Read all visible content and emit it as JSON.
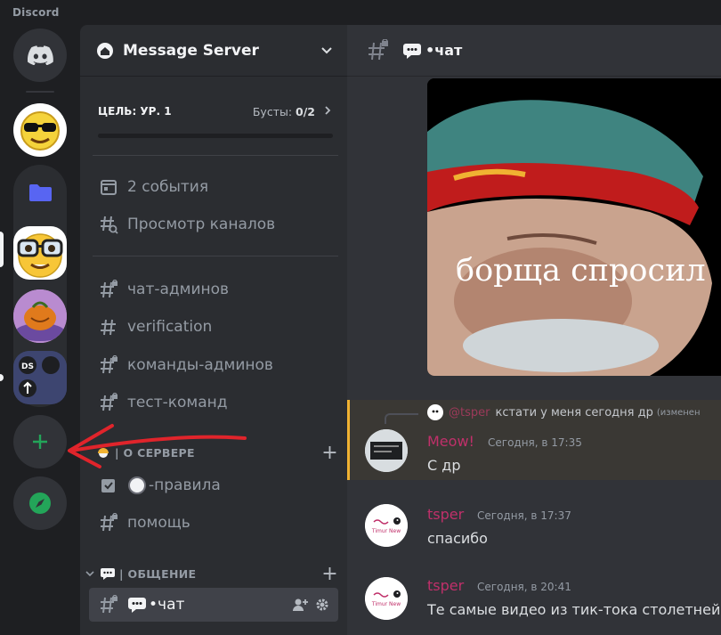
{
  "app": {
    "name": "Discord"
  },
  "server": {
    "name": "Message Server",
    "boost": {
      "goal": "ЦЕЛЬ: УР. 1",
      "label": "Бусты: ",
      "value": "0/2",
      "progress": 0
    }
  },
  "nav": [
    {
      "label": "2 события",
      "icon": "calendar-icon"
    },
    {
      "label": "Просмотр каналов",
      "icon": "browse-channels-icon"
    }
  ],
  "channels": [
    {
      "label": "чат-админов",
      "icon": "locked-hash-icon"
    },
    {
      "label": "verification",
      "icon": "hash-icon"
    },
    {
      "label": "команды-админов",
      "icon": "locked-hash-icon"
    },
    {
      "label": "тест-команд",
      "icon": "locked-hash-icon"
    }
  ],
  "categories": [
    {
      "name": "| О СЕРВЕРЕ",
      "emoji_icon": "sun-emoji-icon"
    },
    {
      "name": "| ОБЩЕНИЕ",
      "emoji_icon": "speech-bubble-icon"
    }
  ],
  "about_channels": [
    {
      "label": "-правила",
      "icon": "rules-icon"
    },
    {
      "label": "помощь",
      "icon": "locked-hash-icon"
    }
  ],
  "active_channel": {
    "label": "•чат",
    "icon": "locked-hash-icon"
  },
  "main": {
    "channel_title": "•чат",
    "media_caption": "борща спросил",
    "messages": [
      {
        "reply": {
          "author": "@tsper",
          "text": "кстати у меня сегодня др",
          "edited": "(изменен"
        },
        "author": "Meow!",
        "time": "Сегодня, в 17:35",
        "text": "С др",
        "author_color": "#c0306a"
      },
      {
        "author": "tsper",
        "time": "Сегодня, в 17:37",
        "text": "спасибо",
        "author_color": "#c0306a"
      },
      {
        "author": "tsper",
        "time": "Сегодня, в 20:41",
        "text": "Те самые видео из тик-тока столетней",
        "author_color": "#c0306a"
      }
    ],
    "avatar_text": "Timur New"
  },
  "colors": {
    "accent": "#5865f2",
    "green": "#23a559",
    "highlight": "#f0b232",
    "annotation": "#e0242b"
  }
}
